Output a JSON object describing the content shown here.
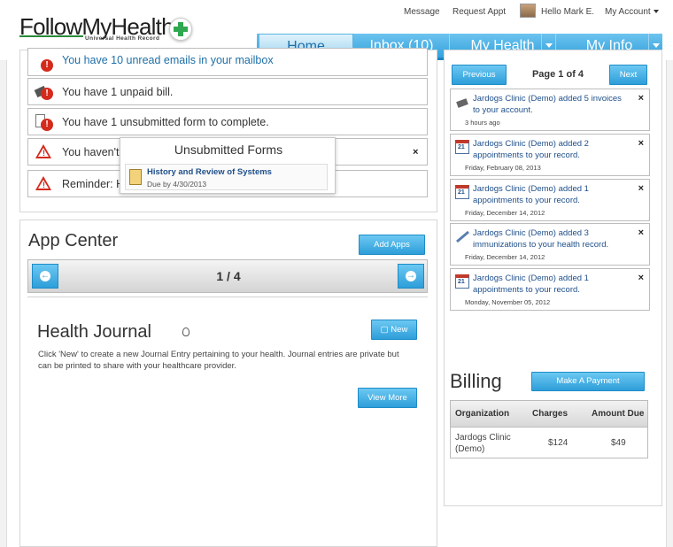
{
  "header": {
    "logo": {
      "name": "FollowMyHealth",
      "tagline": "Universal Health Record"
    },
    "links": {
      "message": "Message",
      "request_appt": "Request Appt",
      "greeting": "Hello Mark E.",
      "my_account": "My Account"
    },
    "nav": [
      {
        "label": "Home",
        "active": true
      },
      {
        "label": "Inbox (10)"
      },
      {
        "label": "My Health"
      },
      {
        "label": "My Info"
      }
    ]
  },
  "alerts": {
    "items": [
      {
        "text": "You have 10 unread emails in your mailbox",
        "icon": "email-alert-icon"
      },
      {
        "text": "You have 1 unpaid bill.",
        "icon": "bill-alert-icon"
      },
      {
        "text": "You have 1 unsubmitted form to complete.",
        "icon": "form-alert-icon"
      },
      {
        "text": "You haven't",
        "icon": "warning-icon"
      },
      {
        "text": "Reminder: H",
        "icon": "warning-icon"
      }
    ],
    "close_glyph": "×"
  },
  "popup": {
    "title": "Unsubmitted Forms",
    "form_name": "History and Review of Systems",
    "due": "Due by 4/30/2013"
  },
  "app_center": {
    "title": "App Center",
    "add_apps": "Add Apps",
    "pager": "1 / 4"
  },
  "health_journal": {
    "title": "Health Journal",
    "new": "New",
    "description": "Click 'New' to create a new Journal Entry pertaining to your health. Journal entries are private but can be printed to share with your healthcare provider.",
    "view_more": "View More"
  },
  "notifications": {
    "previous": "Previous",
    "page": "Page 1 of 4",
    "next": "Next",
    "items": [
      {
        "text": "Jardogs Clinic (Demo) added 5 invoices to your account.",
        "date": "3 hours ago",
        "icon": "invoice-icon"
      },
      {
        "text": "Jardogs Clinic (Demo) added 2 appointments to your record.",
        "date": "Friday, February 08, 2013",
        "icon": "calendar-icon"
      },
      {
        "text": "Jardogs Clinic (Demo) added 1 appointments to your record.",
        "date": "Friday, December 14, 2012",
        "icon": "calendar-icon"
      },
      {
        "text": "Jardogs Clinic (Demo) added 3 immunizations to your health record.",
        "date": "Friday, December 14, 2012",
        "icon": "syringe-icon"
      },
      {
        "text": "Jardogs Clinic (Demo) added 1 appointments to your record.",
        "date": "Monday, November 05, 2012",
        "icon": "calendar-icon"
      }
    ],
    "close_glyph": "×"
  },
  "billing": {
    "title": "Billing",
    "make_payment": "Make A Payment",
    "columns": [
      "Organization",
      "Charges",
      "Amount Due"
    ],
    "rows": [
      {
        "organization": "Jardogs Clinic (Demo)",
        "charges": "$124",
        "amount_due": "$49"
      }
    ]
  },
  "colors": {
    "accent": "#35a2dc",
    "alert_red": "#d42a1c",
    "link_blue": "#1f4f8a"
  }
}
